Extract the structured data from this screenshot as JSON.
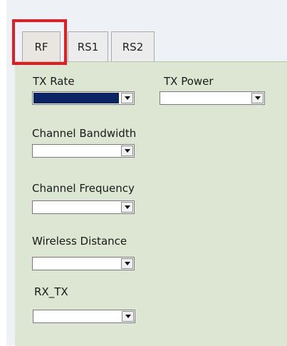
{
  "tabs": [
    {
      "label": "RF",
      "selected": true
    },
    {
      "label": "RS1",
      "selected": false
    },
    {
      "label": "RS2",
      "selected": false
    }
  ],
  "fields": {
    "tx_rate": {
      "label": "TX Rate",
      "value": ""
    },
    "tx_power": {
      "label": "TX Power",
      "value": ""
    },
    "channel_bandwidth": {
      "label": "Channel Bandwidth",
      "value": ""
    },
    "channel_frequency": {
      "label": "Channel Frequency",
      "value": ""
    },
    "wireless_distance": {
      "label": "Wireless Distance",
      "value": ""
    },
    "rx_tx": {
      "label": "RX_TX",
      "value": ""
    }
  },
  "colors": {
    "panel_background": "#dde5d3",
    "highlight_border": "#e31b23",
    "selected_value_fill": "#0a2463"
  },
  "icons": {
    "dropdown": "chevron-down-icon"
  }
}
